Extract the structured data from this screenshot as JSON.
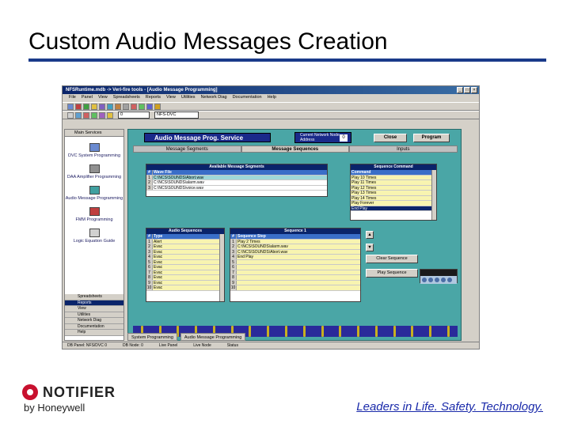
{
  "slide": {
    "title": "Custom Audio Messages Creation",
    "tagline": "Leaders in Life. Safety. Technology.",
    "logo_name": "NOTIFIER",
    "logo_sub": "by Honeywell"
  },
  "app": {
    "window_title": "NFSRuntime.mdb  ->  Veri-fire tools - [Audio Message Programming]",
    "menu": [
      "File",
      "Panel",
      "View",
      "Spreadsheets",
      "Reports",
      "View",
      "Utilities",
      "Network Diag",
      "Documentation",
      "Help"
    ],
    "combo_value": "0",
    "panel_combo": "NFS-DVC"
  },
  "nav": {
    "header": "Main Services",
    "items": [
      "DVC System Programming",
      "DAA Amplifier Programming",
      "Audio Message Programming",
      "FMM Programming",
      "Logic Equation Guide"
    ],
    "list": [
      "Spreadsheets",
      "Reports",
      "View",
      "Utilities",
      "Network Diag",
      "Documentation",
      "Help"
    ],
    "selected": "Reports"
  },
  "service": {
    "title": "Audio Message Prog. Service",
    "network_label": "Current Network Node Address",
    "network_value": "0",
    "close": "Close",
    "program": "Program",
    "tabs": [
      "Message Segments",
      "Message Sequences",
      "Inputs"
    ]
  },
  "available_segments": {
    "title": "Available Message Segments",
    "head": [
      "#",
      "Wave File"
    ],
    "rows": [
      {
        "n": "1",
        "v": "C:\\NCS\\SOUNDS\\Abort.wav"
      },
      {
        "n": "2",
        "v": "C:\\NCS\\SOUNDS\\alarm.wav"
      },
      {
        "n": "3",
        "v": "C:\\NCS\\SOUNDS\\voice.wav"
      }
    ]
  },
  "sequence_command": {
    "title": "Sequence Command",
    "head": "Command",
    "rows": [
      "Play 10 Times",
      "Play 11 Times",
      "Play 12 Times",
      "Play 13 Times",
      "Play 14 Times",
      "Play Forever",
      "End Play"
    ]
  },
  "audio_sequences": {
    "title": "Audio Sequences",
    "head": [
      "#",
      "Type"
    ],
    "rows": [
      {
        "n": "1",
        "t": "Alert"
      },
      {
        "n": "2",
        "t": "Evac"
      },
      {
        "n": "3",
        "t": "Evac"
      },
      {
        "n": "4",
        "t": "Evac"
      },
      {
        "n": "5",
        "t": "Evac"
      },
      {
        "n": "6",
        "t": "Evac"
      },
      {
        "n": "7",
        "t": "Evac"
      },
      {
        "n": "8",
        "t": "Evac"
      },
      {
        "n": "9",
        "t": "Evac"
      },
      {
        "n": "10",
        "t": "Evac"
      }
    ]
  },
  "sequence_one": {
    "title": "Sequence 1",
    "head": [
      "#",
      "Sequence Step"
    ],
    "rows": [
      {
        "n": "1",
        "s": "Play 2 Times"
      },
      {
        "n": "2",
        "s": "C:\\NCS\\SOUNDS\\alarm.wav"
      },
      {
        "n": "3",
        "s": "C:\\NCS\\SOUNDS\\Abort.wav"
      },
      {
        "n": "4",
        "s": "End Play"
      },
      {
        "n": "5",
        "s": ""
      },
      {
        "n": "6",
        "s": ""
      },
      {
        "n": "7",
        "s": ""
      },
      {
        "n": "8",
        "s": ""
      },
      {
        "n": "9",
        "s": ""
      },
      {
        "n": "10",
        "s": ""
      }
    ]
  },
  "buttons": {
    "clear": "Clear Sequence",
    "play": "Play Sequence"
  },
  "taskbar": [
    "System Programming",
    "Audio Message Programming"
  ],
  "status": [
    "DB Panel: NFS/DVC 0",
    "DB Node: 0",
    "Live Panel",
    "Live Node",
    "Status"
  ]
}
